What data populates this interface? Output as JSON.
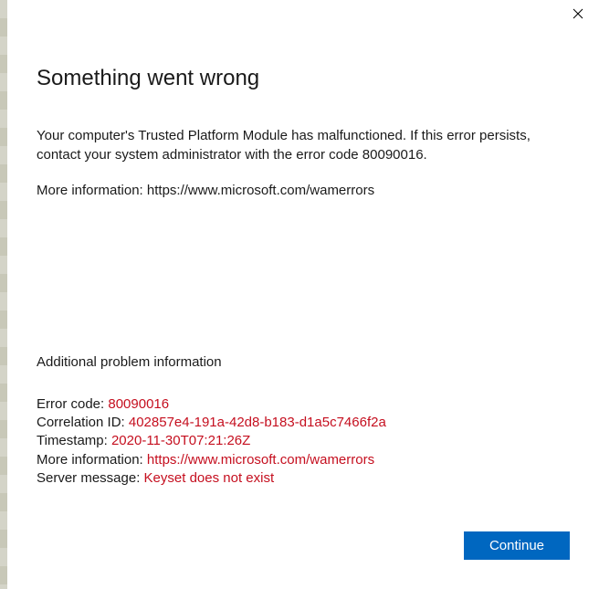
{
  "dialog": {
    "heading": "Something went wrong",
    "body": "Your computer's Trusted Platform Module has malfunctioned. If this error persists, contact your system administrator with the error code 80090016.",
    "more_info_label": "More information: ",
    "more_info_url": "https://www.microsoft.com/wamerrors",
    "additional_heading": "Additional problem information",
    "details": {
      "error_code_label": "Error code: ",
      "error_code_value": "80090016",
      "correlation_label": "Correlation ID: ",
      "correlation_value": "402857e4-191a-42d8-b183-d1a5c7466f2a",
      "timestamp_label": "Timestamp: ",
      "timestamp_value": "2020-11-30T07:21:26Z",
      "more_info_label": "More information: ",
      "more_info_value": "https://www.microsoft.com/wamerrors",
      "server_msg_label": "Server message: ",
      "server_msg_value": "Keyset does not exist"
    },
    "continue_label": "Continue"
  }
}
